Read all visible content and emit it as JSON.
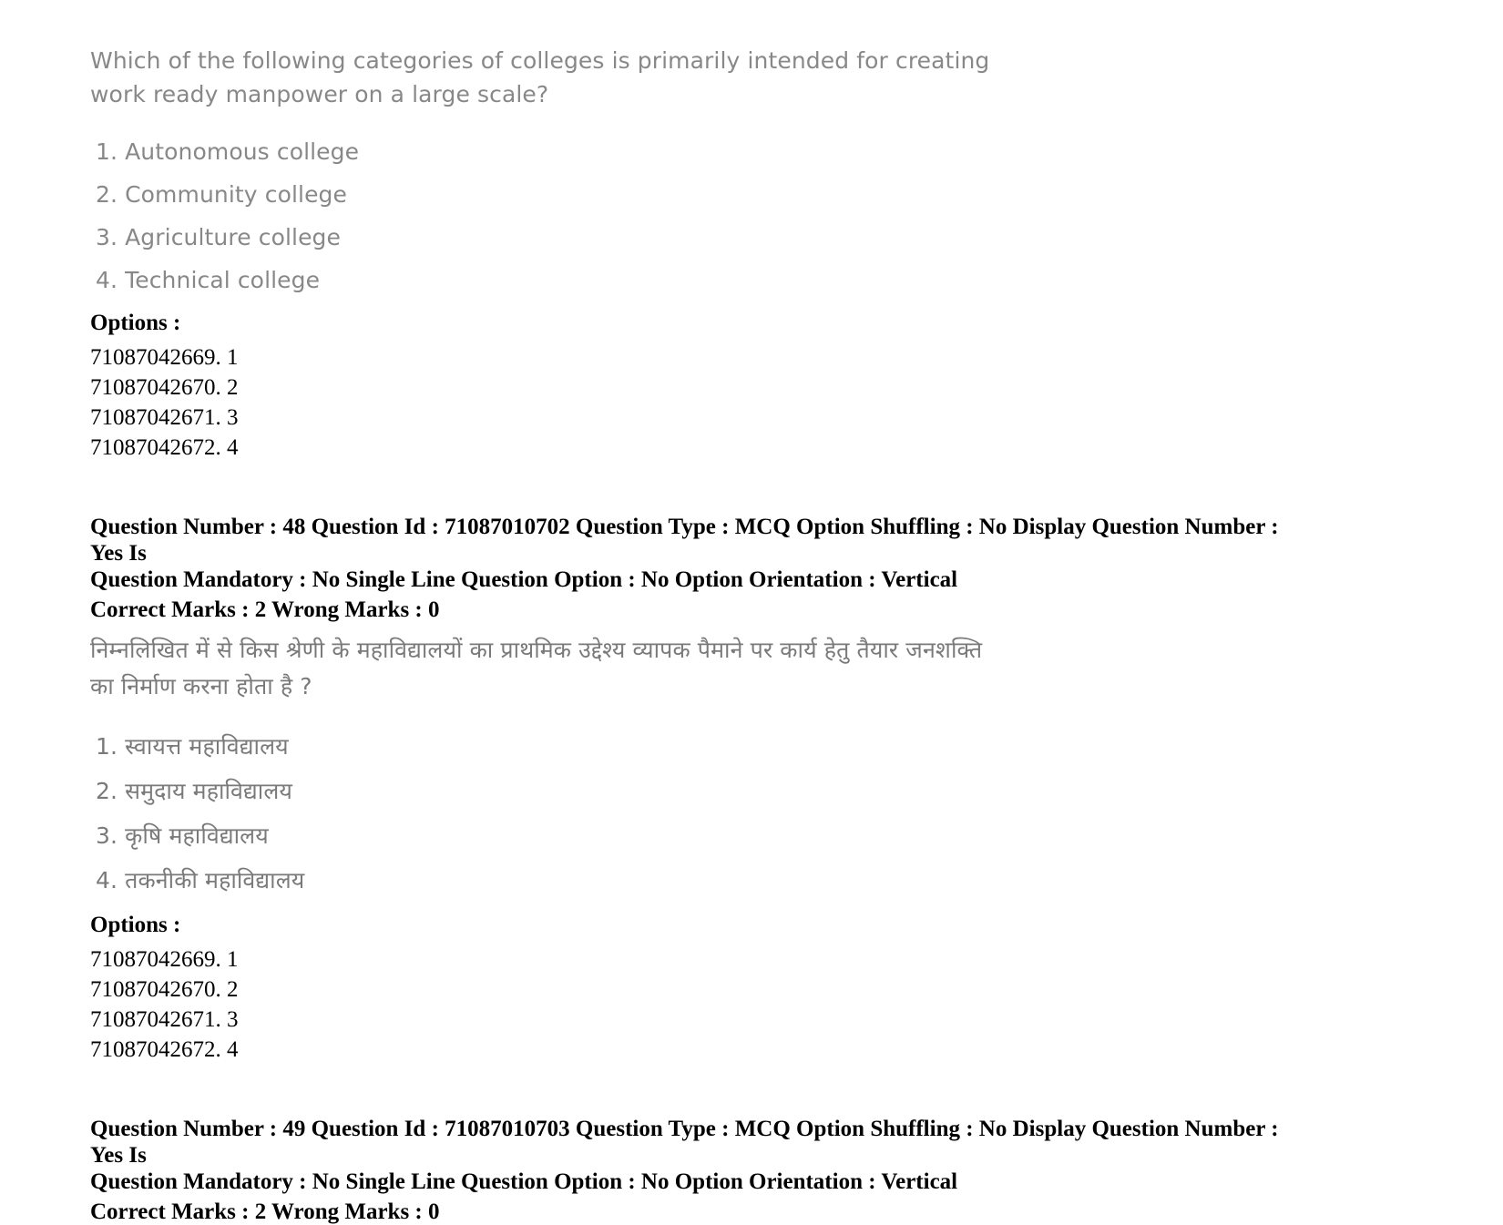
{
  "document": {
    "type": "exam-answer-key-page"
  },
  "question_47": {
    "stem": "Which of the following categories of colleges is primarily intended for creating work ready manpower on a large scale?",
    "choices": [
      "1. Autonomous college",
      "2. Community college",
      "3. Agriculture college",
      "4. Technical college"
    ],
    "options_heading": "Options :",
    "option_ids": [
      "71087042669. 1",
      "71087042670. 2",
      "71087042671. 3",
      "71087042672. 4"
    ]
  },
  "question_48": {
    "meta_line_1": "Question Number : 48 Question Id : 71087010702 Question Type : MCQ Option Shuffling : No Display Question Number : Yes Is",
    "meta_line_2": "Question Mandatory : No Single Line Question Option : No Option Orientation : Vertical",
    "marks_line": "Correct Marks : 2 Wrong Marks : 0",
    "stem": "निम्नलिखित में से किस श्रेणी के महाविद्यालयों का प्राथमिक उद्देश्य व्यापक पैमाने पर कार्य हेतु तैयार जनशक्ति का निर्माण करना होता है ?",
    "choices": [
      "1. स्वायत्त महाविद्यालय",
      "2. समुदाय महाविद्यालय",
      "3. कृषि महाविद्यालय",
      "4. तकनीकी महाविद्यालय"
    ],
    "options_heading": "Options :",
    "option_ids": [
      "71087042669. 1",
      "71087042670. 2",
      "71087042671. 3",
      "71087042672. 4"
    ]
  },
  "question_49": {
    "meta_line_1": "Question Number : 49 Question Id : 71087010703 Question Type : MCQ Option Shuffling : No Display Question Number : Yes Is",
    "meta_line_2": "Question Mandatory : No Single Line Question Option : No Option Orientation : Vertical",
    "marks_line": "Correct Marks : 2 Wrong Marks : 0"
  }
}
